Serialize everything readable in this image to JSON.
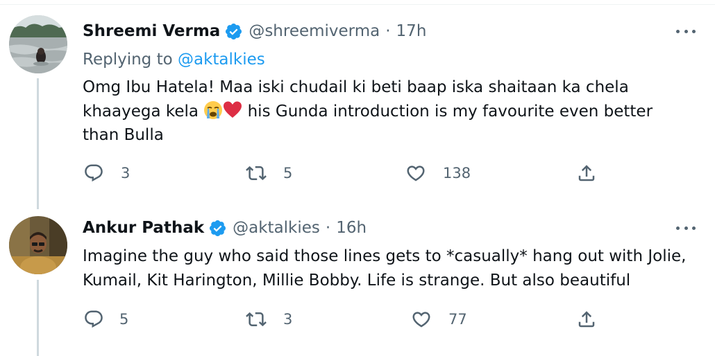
{
  "tweets": [
    {
      "display_name": "Shreemi Verma",
      "handle": "@shreemiverma",
      "separator": "·",
      "time": "17h",
      "replying_prefix": "Replying to",
      "replying_handle": "@aktalkies",
      "text_before_emoji": "Omg Ibu Hatela! Maa iski chudail ki beti baap iska shaitaan ka chela khaayega kela ",
      "emojis": [
        "loudly-crying-face",
        "red-heart"
      ],
      "text_after_emoji": " his Gunda introduction is my favourite even better than Bulla",
      "reply_count": "3",
      "retweet_count": "5",
      "like_count": "138"
    },
    {
      "display_name": "Ankur Pathak",
      "handle": "@aktalkies",
      "separator": "·",
      "time": "16h",
      "text": "Imagine the guy who said those lines gets to *casually* hang out with Jolie, Kumail, Kit Harington, Millie Bobby. Life is strange. But also beautiful",
      "reply_count": "5",
      "retweet_count": "3",
      "like_count": "77"
    }
  ],
  "colors": {
    "text": "#0f1419",
    "secondary": "#536471",
    "link": "#1d9bf0",
    "verified": "#1d9bf0",
    "thread_line": "#cfd9de"
  },
  "icons": [
    "verified-badge-icon",
    "more-icon",
    "reply-icon",
    "retweet-icon",
    "like-icon",
    "share-icon"
  ]
}
